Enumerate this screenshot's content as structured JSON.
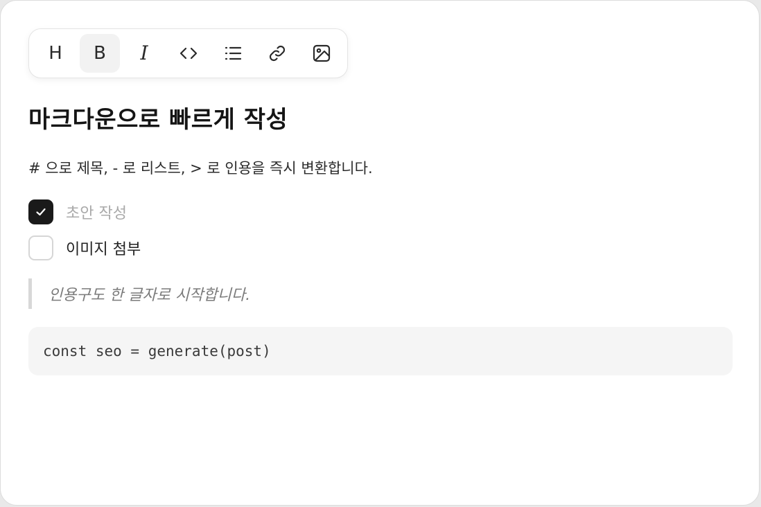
{
  "toolbar": {
    "buttons": [
      {
        "icon": "heading-icon",
        "glyph": "H",
        "active": false
      },
      {
        "icon": "bold-icon",
        "glyph": "B",
        "active": true
      },
      {
        "icon": "italic-icon",
        "glyph": "I",
        "active": false
      },
      {
        "icon": "code-icon",
        "glyph": "",
        "active": false
      },
      {
        "icon": "list-icon",
        "glyph": "",
        "active": false
      },
      {
        "icon": "link-icon",
        "glyph": "",
        "active": false
      },
      {
        "icon": "image-icon",
        "glyph": "",
        "active": false
      }
    ]
  },
  "content": {
    "title": "마크다운으로 빠르게 작성",
    "description": "# 으로 제목, - 로 리스트, > 로 인용을 즉시 변환합니다.",
    "tasks": [
      {
        "label": "초안 작성",
        "checked": true
      },
      {
        "label": "이미지 첨부",
        "checked": false
      }
    ],
    "quote": "인용구도 한 글자로 시작합니다.",
    "code": "const seo = generate(post)"
  },
  "colors": {
    "checked_box": "#1a1a1a",
    "active_button_bg": "#f2f2f2",
    "code_bg": "#f5f5f5",
    "quote_bar": "#d8d8d8"
  }
}
